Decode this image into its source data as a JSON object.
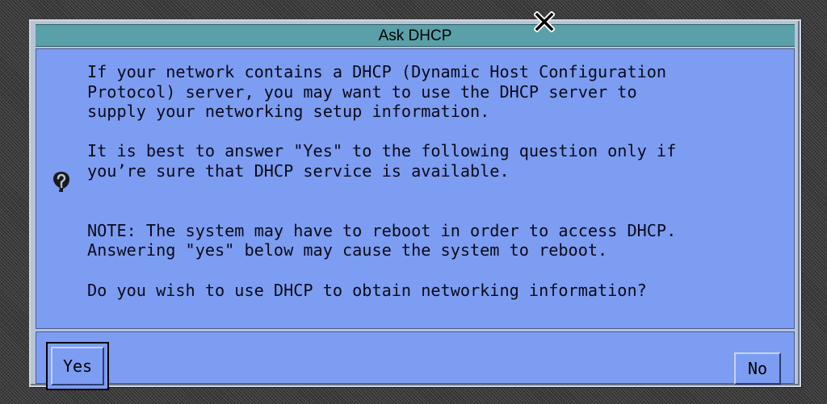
{
  "dialog": {
    "title": "Ask DHCP",
    "message": "If your network contains a DHCP (Dynamic Host Configuration\nProtocol) server, you may want to use the DHCP server to\nsupply your networking setup information.\n\nIt is best to answer \"Yes\" to the following question only if\nyou’re sure that DHCP service is available.\n\n\nNOTE: The system may have to reboot in order to access DHCP.\nAnswering \"yes\" below may cause the system to reboot.\n\nDo you wish to use DHCP to obtain networking information?",
    "icon": "question-icon",
    "buttons": {
      "yes_label": "Yes",
      "no_label": "No"
    }
  },
  "pointer": {
    "icon": "x-cursor-icon"
  },
  "colors": {
    "title_bar": "#5aa0a8",
    "panel": "#7d9df2",
    "frame": "#b7c3d6",
    "desktop": "#3a3a3a"
  }
}
